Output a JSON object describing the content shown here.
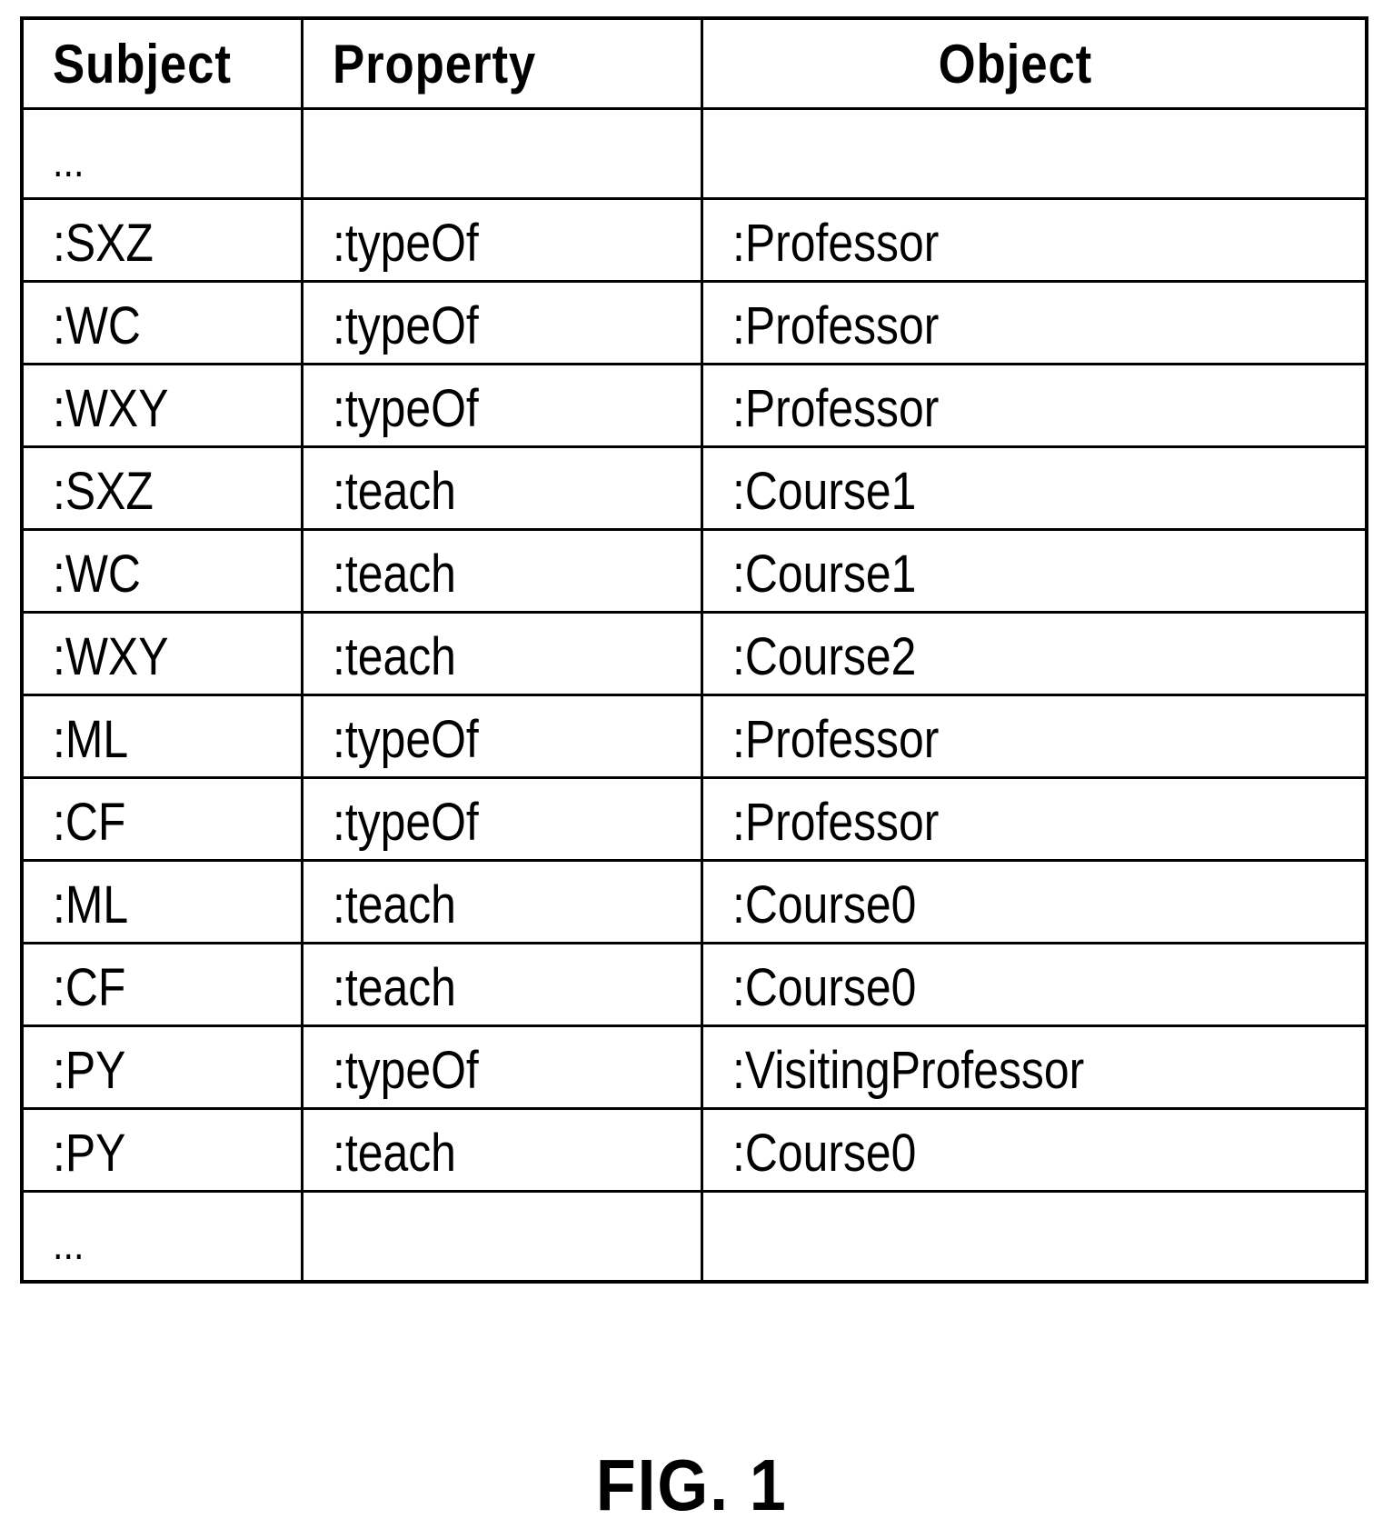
{
  "table": {
    "headers": {
      "subject": "Subject",
      "property": "Property",
      "object": "Object"
    },
    "rows": [
      {
        "subject": "...",
        "property": "",
        "object": "",
        "ellipsis": true
      },
      {
        "subject": ":SXZ",
        "property": ":typeOf",
        "object": ":Professor"
      },
      {
        "subject": ":WC",
        "property": ":typeOf",
        "object": ":Professor"
      },
      {
        "subject": ":WXY",
        "property": ":typeOf",
        "object": ":Professor"
      },
      {
        "subject": ":SXZ",
        "property": ":teach",
        "object": ":Course1"
      },
      {
        "subject": ":WC",
        "property": ":teach",
        "object": ":Course1"
      },
      {
        "subject": ":WXY",
        "property": ":teach",
        "object": ":Course2"
      },
      {
        "subject": ":ML",
        "property": ":typeOf",
        "object": ":Professor"
      },
      {
        "subject": ":CF",
        "property": ":typeOf",
        "object": ":Professor"
      },
      {
        "subject": ":ML",
        "property": ":teach",
        "object": ":Course0"
      },
      {
        "subject": ":CF",
        "property": ":teach",
        "object": ":Course0"
      },
      {
        "subject": ":PY",
        "property": ":typeOf",
        "object": ":VisitingProfessor"
      },
      {
        "subject": ":PY",
        "property": ":teach",
        "object": ":Course0"
      },
      {
        "subject": "...",
        "property": "",
        "object": "",
        "ellipsis": true
      }
    ]
  },
  "caption": "FIG. 1"
}
